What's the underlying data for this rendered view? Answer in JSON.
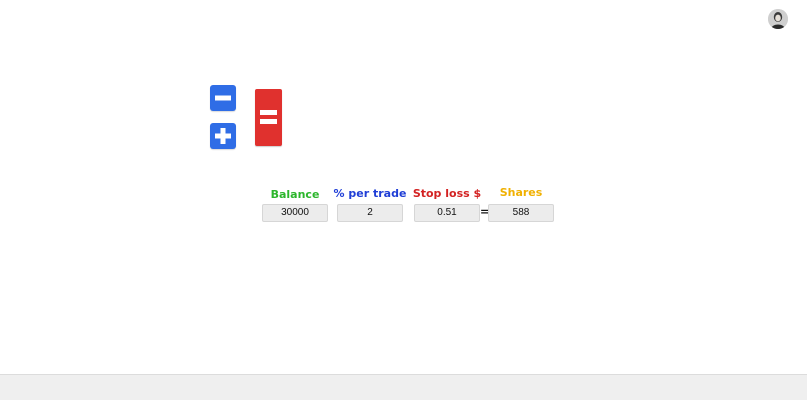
{
  "header": {
    "avatar_icon": "user-avatar-icon"
  },
  "controls": {
    "decrement_icon": "minus-icon",
    "increment_icon": "plus-icon",
    "calculate_icon": "equals-icon",
    "blue": "#2f6de6",
    "red": "#e0312e"
  },
  "calculator": {
    "balance": {
      "label": "Balance",
      "value": "30000",
      "color": "#2bb52b"
    },
    "percent": {
      "label": "% per trade",
      "value": "2",
      "color": "#1f3ed6"
    },
    "stop_loss": {
      "label": "Stop loss $",
      "value": "0.51",
      "color": "#d32222"
    },
    "equals": "=",
    "shares": {
      "label": "Shares",
      "value": "588",
      "color": "#f0b000"
    }
  }
}
